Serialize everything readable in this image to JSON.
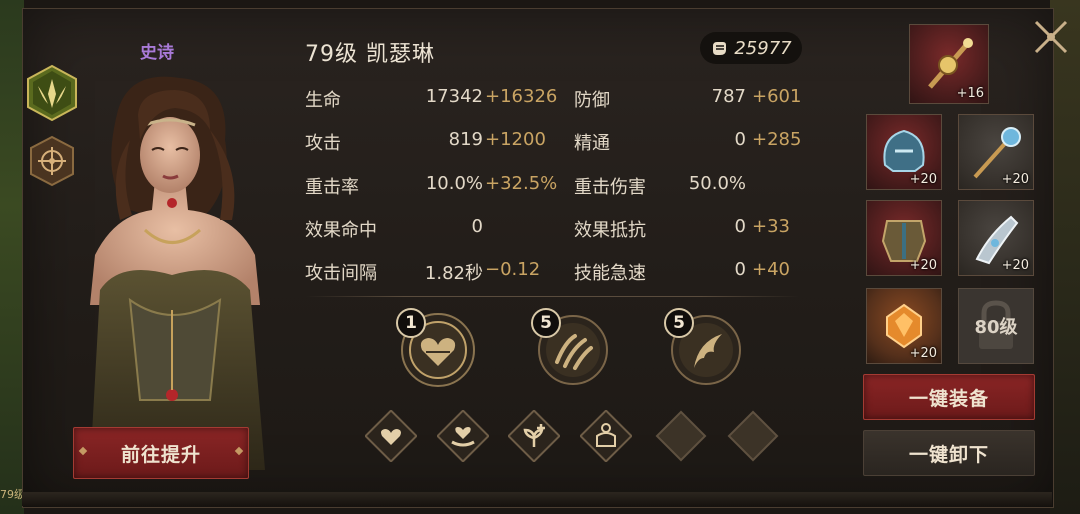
{
  "hero": {
    "rarity": "史诗",
    "title": "79级  凯瑟琳",
    "power": "25977",
    "corner_level_text": "79级"
  },
  "stats": [
    {
      "label": "生命",
      "base": "17342",
      "bonus": "+16326"
    },
    {
      "label": "防御",
      "base": "787",
      "bonus": "+601"
    },
    {
      "label": "攻击",
      "base": "819",
      "bonus": "+1200"
    },
    {
      "label": "精通",
      "base": "0",
      "bonus": "+285"
    },
    {
      "label": "重击率",
      "base": "10.0%",
      "bonus": "+32.5%"
    },
    {
      "label": "重击伤害",
      "base": "50.0%",
      "bonus": ""
    },
    {
      "label": "效果命中",
      "base": "0",
      "bonus": ""
    },
    {
      "label": "效果抵抗",
      "base": "0",
      "bonus": "+33"
    },
    {
      "label": "攻击间隔",
      "base": "1.82秒",
      "bonus": "−0.12"
    },
    {
      "label": "技能急速",
      "base": "0",
      "bonus": "+40"
    }
  ],
  "skills": [
    {
      "level": "1",
      "icon": "heart-shield-skill-icon"
    },
    {
      "level": "5",
      "icon": "hands-skill-icon"
    },
    {
      "level": "5",
      "icon": "wing-skill-icon"
    }
  ],
  "runes": [
    {
      "icon": "heart-rune-icon",
      "unlocked": true
    },
    {
      "icon": "heart-hand-rune-icon",
      "unlocked": true
    },
    {
      "icon": "sprout-plus-rune-icon",
      "unlocked": true
    },
    {
      "icon": "figure-rune-icon",
      "unlocked": true
    },
    {
      "icon": "empty-rune-slot",
      "unlocked": false
    },
    {
      "icon": "empty-rune-slot",
      "unlocked": false
    }
  ],
  "equipment": {
    "weapon": {
      "level": "+16",
      "icon": "scepter-icon"
    },
    "helmet": {
      "level": "+20",
      "icon": "helmet-icon"
    },
    "staff": {
      "level": "+20",
      "icon": "staff-icon"
    },
    "armor": {
      "level": "+20",
      "icon": "armor-icon"
    },
    "gauntlet": {
      "level": "+20",
      "icon": "gauntlet-icon"
    },
    "gem": {
      "level": "+20",
      "icon": "gem-icon"
    },
    "locked_slot": {
      "text": "80级",
      "icon": "lock-icon"
    }
  },
  "buttons": {
    "upgrade": "前往提升",
    "equip_all": "一键装备",
    "unequip_all": "一键卸下"
  },
  "colors": {
    "rarity": "#a97ad8",
    "bonus": "#c9a463",
    "accent_red": "#8a2525"
  }
}
